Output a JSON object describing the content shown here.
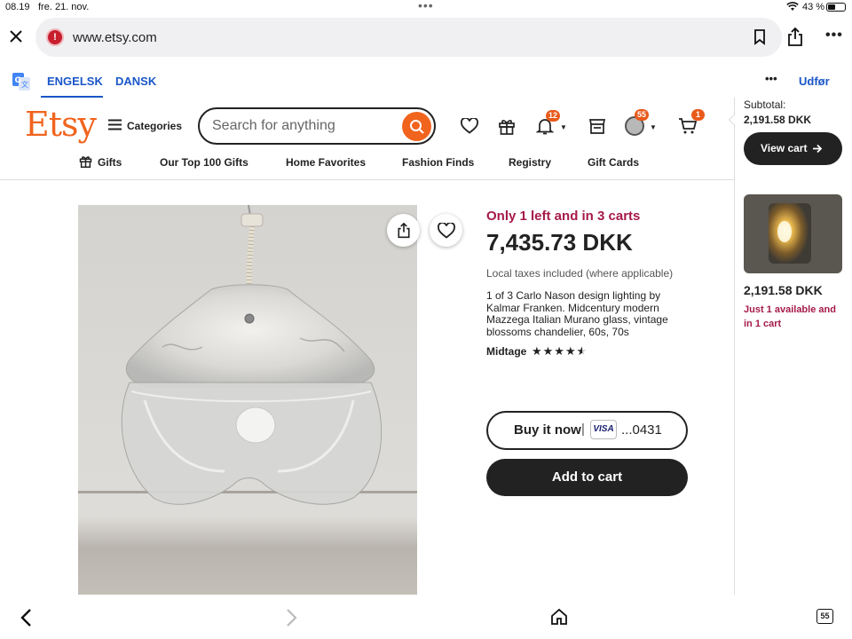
{
  "status_bar": {
    "time": "08.19",
    "date": "fre. 21. nov.",
    "battery": "43 %"
  },
  "browser": {
    "url": "www.etsy.com"
  },
  "translate_bar": {
    "lang_active": "ENGELSK",
    "lang_other": "DANSK",
    "done": "Udfør"
  },
  "header": {
    "logo": "Etsy",
    "categories": "Categories",
    "search_placeholder": "Search for anything",
    "notifications_badge": "12",
    "account_badge": "55",
    "cart_badge": "1"
  },
  "subnav": [
    "Gifts",
    "Our Top 100 Gifts",
    "Home Favorites",
    "Fashion Finds",
    "Registry",
    "Gift Cards"
  ],
  "product": {
    "stock": "Only 1 left and in 3 carts",
    "price": "7,435.73 DKK",
    "tax": "Local taxes included (where applicable)",
    "title_lines": [
      "1 of 3 Carlo Nason design lighting by",
      "Kalmar Franken. Midcentury modern",
      "Mazzega Italian Murano glass, vintage",
      "blossoms chandelier, 60s, 70s"
    ],
    "shop": "Midtage",
    "rating": 4.5,
    "buy_now": "Buy it now",
    "card_brand": "VISA",
    "card_last": "...0431",
    "add_to_cart": "Add to cart"
  },
  "cart_panel": {
    "subtotal_label": "Subtotal:",
    "subtotal": "2,191.58 DKK",
    "view_cart": "View cart",
    "item_price": "2,191.58 DKK",
    "item_note_1": "Just 1 available and",
    "item_note_2": "in 1 cart"
  },
  "tabs_count": "55",
  "colors": {
    "accent": "#f1641e",
    "alert": "#a61a4a",
    "dark": "#222222"
  }
}
